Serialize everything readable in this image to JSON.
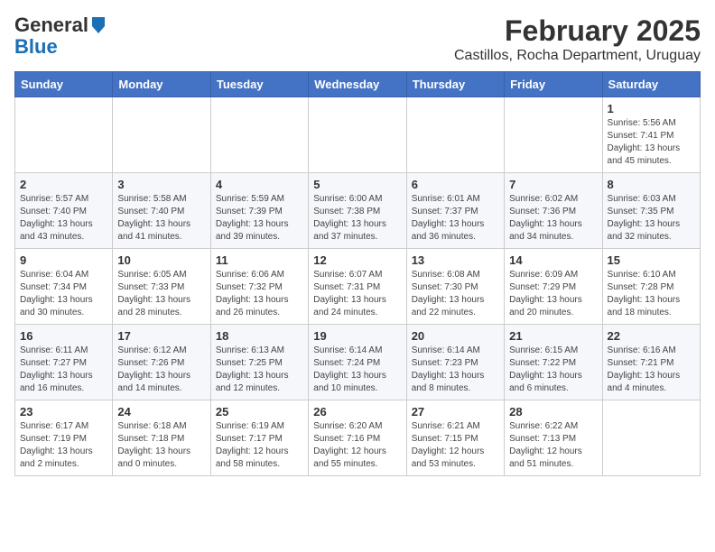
{
  "header": {
    "logo_general": "General",
    "logo_blue": "Blue",
    "title": "February 2025",
    "subtitle": "Castillos, Rocha Department, Uruguay"
  },
  "weekdays": [
    "Sunday",
    "Monday",
    "Tuesday",
    "Wednesday",
    "Thursday",
    "Friday",
    "Saturday"
  ],
  "weeks": [
    [
      {
        "day": "",
        "info": ""
      },
      {
        "day": "",
        "info": ""
      },
      {
        "day": "",
        "info": ""
      },
      {
        "day": "",
        "info": ""
      },
      {
        "day": "",
        "info": ""
      },
      {
        "day": "",
        "info": ""
      },
      {
        "day": "1",
        "info": "Sunrise: 5:56 AM\nSunset: 7:41 PM\nDaylight: 13 hours\nand 45 minutes."
      }
    ],
    [
      {
        "day": "2",
        "info": "Sunrise: 5:57 AM\nSunset: 7:40 PM\nDaylight: 13 hours\nand 43 minutes."
      },
      {
        "day": "3",
        "info": "Sunrise: 5:58 AM\nSunset: 7:40 PM\nDaylight: 13 hours\nand 41 minutes."
      },
      {
        "day": "4",
        "info": "Sunrise: 5:59 AM\nSunset: 7:39 PM\nDaylight: 13 hours\nand 39 minutes."
      },
      {
        "day": "5",
        "info": "Sunrise: 6:00 AM\nSunset: 7:38 PM\nDaylight: 13 hours\nand 37 minutes."
      },
      {
        "day": "6",
        "info": "Sunrise: 6:01 AM\nSunset: 7:37 PM\nDaylight: 13 hours\nand 36 minutes."
      },
      {
        "day": "7",
        "info": "Sunrise: 6:02 AM\nSunset: 7:36 PM\nDaylight: 13 hours\nand 34 minutes."
      },
      {
        "day": "8",
        "info": "Sunrise: 6:03 AM\nSunset: 7:35 PM\nDaylight: 13 hours\nand 32 minutes."
      }
    ],
    [
      {
        "day": "9",
        "info": "Sunrise: 6:04 AM\nSunset: 7:34 PM\nDaylight: 13 hours\nand 30 minutes."
      },
      {
        "day": "10",
        "info": "Sunrise: 6:05 AM\nSunset: 7:33 PM\nDaylight: 13 hours\nand 28 minutes."
      },
      {
        "day": "11",
        "info": "Sunrise: 6:06 AM\nSunset: 7:32 PM\nDaylight: 13 hours\nand 26 minutes."
      },
      {
        "day": "12",
        "info": "Sunrise: 6:07 AM\nSunset: 7:31 PM\nDaylight: 13 hours\nand 24 minutes."
      },
      {
        "day": "13",
        "info": "Sunrise: 6:08 AM\nSunset: 7:30 PM\nDaylight: 13 hours\nand 22 minutes."
      },
      {
        "day": "14",
        "info": "Sunrise: 6:09 AM\nSunset: 7:29 PM\nDaylight: 13 hours\nand 20 minutes."
      },
      {
        "day": "15",
        "info": "Sunrise: 6:10 AM\nSunset: 7:28 PM\nDaylight: 13 hours\nand 18 minutes."
      }
    ],
    [
      {
        "day": "16",
        "info": "Sunrise: 6:11 AM\nSunset: 7:27 PM\nDaylight: 13 hours\nand 16 minutes."
      },
      {
        "day": "17",
        "info": "Sunrise: 6:12 AM\nSunset: 7:26 PM\nDaylight: 13 hours\nand 14 minutes."
      },
      {
        "day": "18",
        "info": "Sunrise: 6:13 AM\nSunset: 7:25 PM\nDaylight: 13 hours\nand 12 minutes."
      },
      {
        "day": "19",
        "info": "Sunrise: 6:14 AM\nSunset: 7:24 PM\nDaylight: 13 hours\nand 10 minutes."
      },
      {
        "day": "20",
        "info": "Sunrise: 6:14 AM\nSunset: 7:23 PM\nDaylight: 13 hours\nand 8 minutes."
      },
      {
        "day": "21",
        "info": "Sunrise: 6:15 AM\nSunset: 7:22 PM\nDaylight: 13 hours\nand 6 minutes."
      },
      {
        "day": "22",
        "info": "Sunrise: 6:16 AM\nSunset: 7:21 PM\nDaylight: 13 hours\nand 4 minutes."
      }
    ],
    [
      {
        "day": "23",
        "info": "Sunrise: 6:17 AM\nSunset: 7:19 PM\nDaylight: 13 hours\nand 2 minutes."
      },
      {
        "day": "24",
        "info": "Sunrise: 6:18 AM\nSunset: 7:18 PM\nDaylight: 13 hours\nand 0 minutes."
      },
      {
        "day": "25",
        "info": "Sunrise: 6:19 AM\nSunset: 7:17 PM\nDaylight: 12 hours\nand 58 minutes."
      },
      {
        "day": "26",
        "info": "Sunrise: 6:20 AM\nSunset: 7:16 PM\nDaylight: 12 hours\nand 55 minutes."
      },
      {
        "day": "27",
        "info": "Sunrise: 6:21 AM\nSunset: 7:15 PM\nDaylight: 12 hours\nand 53 minutes."
      },
      {
        "day": "28",
        "info": "Sunrise: 6:22 AM\nSunset: 7:13 PM\nDaylight: 12 hours\nand 51 minutes."
      },
      {
        "day": "",
        "info": ""
      }
    ]
  ]
}
